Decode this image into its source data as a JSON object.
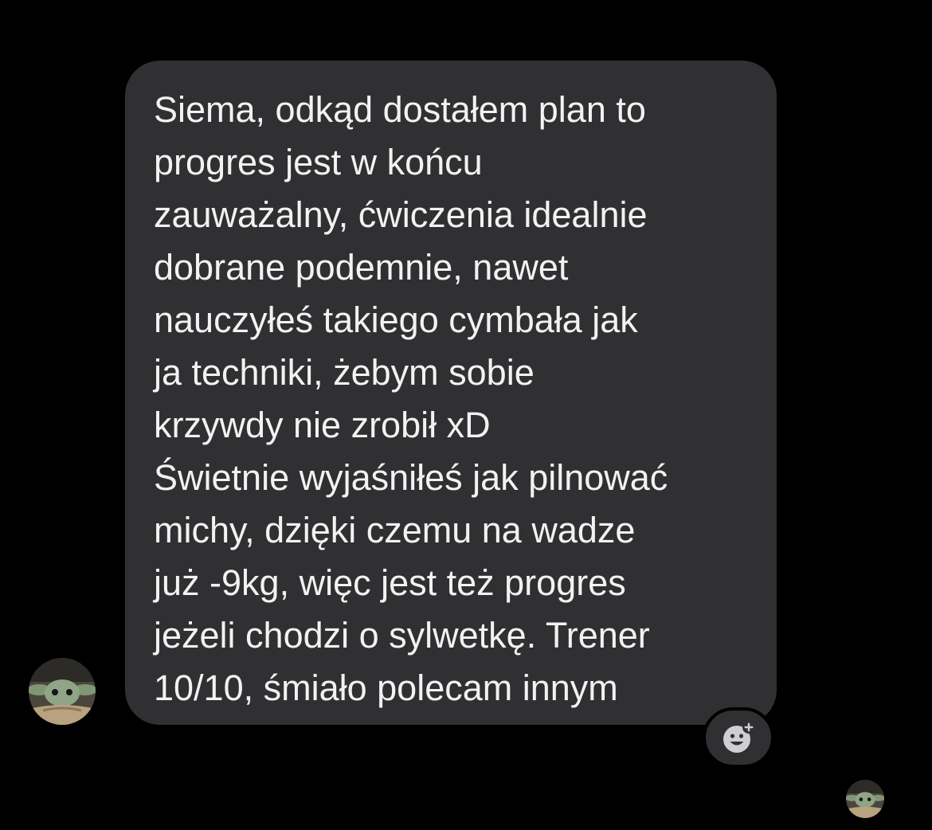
{
  "message": {
    "lines": [
      "Siema, odkąd dostałem plan to",
      "progres jest w końcu",
      "zauważalny, ćwiczenia idealnie",
      "dobrane podemnie, nawet",
      "nauczyłeś takiego cymbała jak",
      "ja techniki, żebym sobie",
      "krzywdy nie zrobił xD",
      "Świetnie wyjaśniłeś jak pilnować",
      "michy, dzięki czemu na wadze",
      "już -9kg, więc jest też progres",
      "jeżeli chodzi o sylwetkę. Trener",
      "10/10, śmiało polecam innym"
    ]
  },
  "icons": {
    "sender_avatar": "baby-yoda-avatar-icon",
    "read_receipt_avatar": "baby-yoda-avatar-icon",
    "reaction": "add-reaction-smiley-icon"
  },
  "colors": {
    "background": "#000000",
    "bubble": "#303032",
    "text": "#f2f2f2"
  }
}
